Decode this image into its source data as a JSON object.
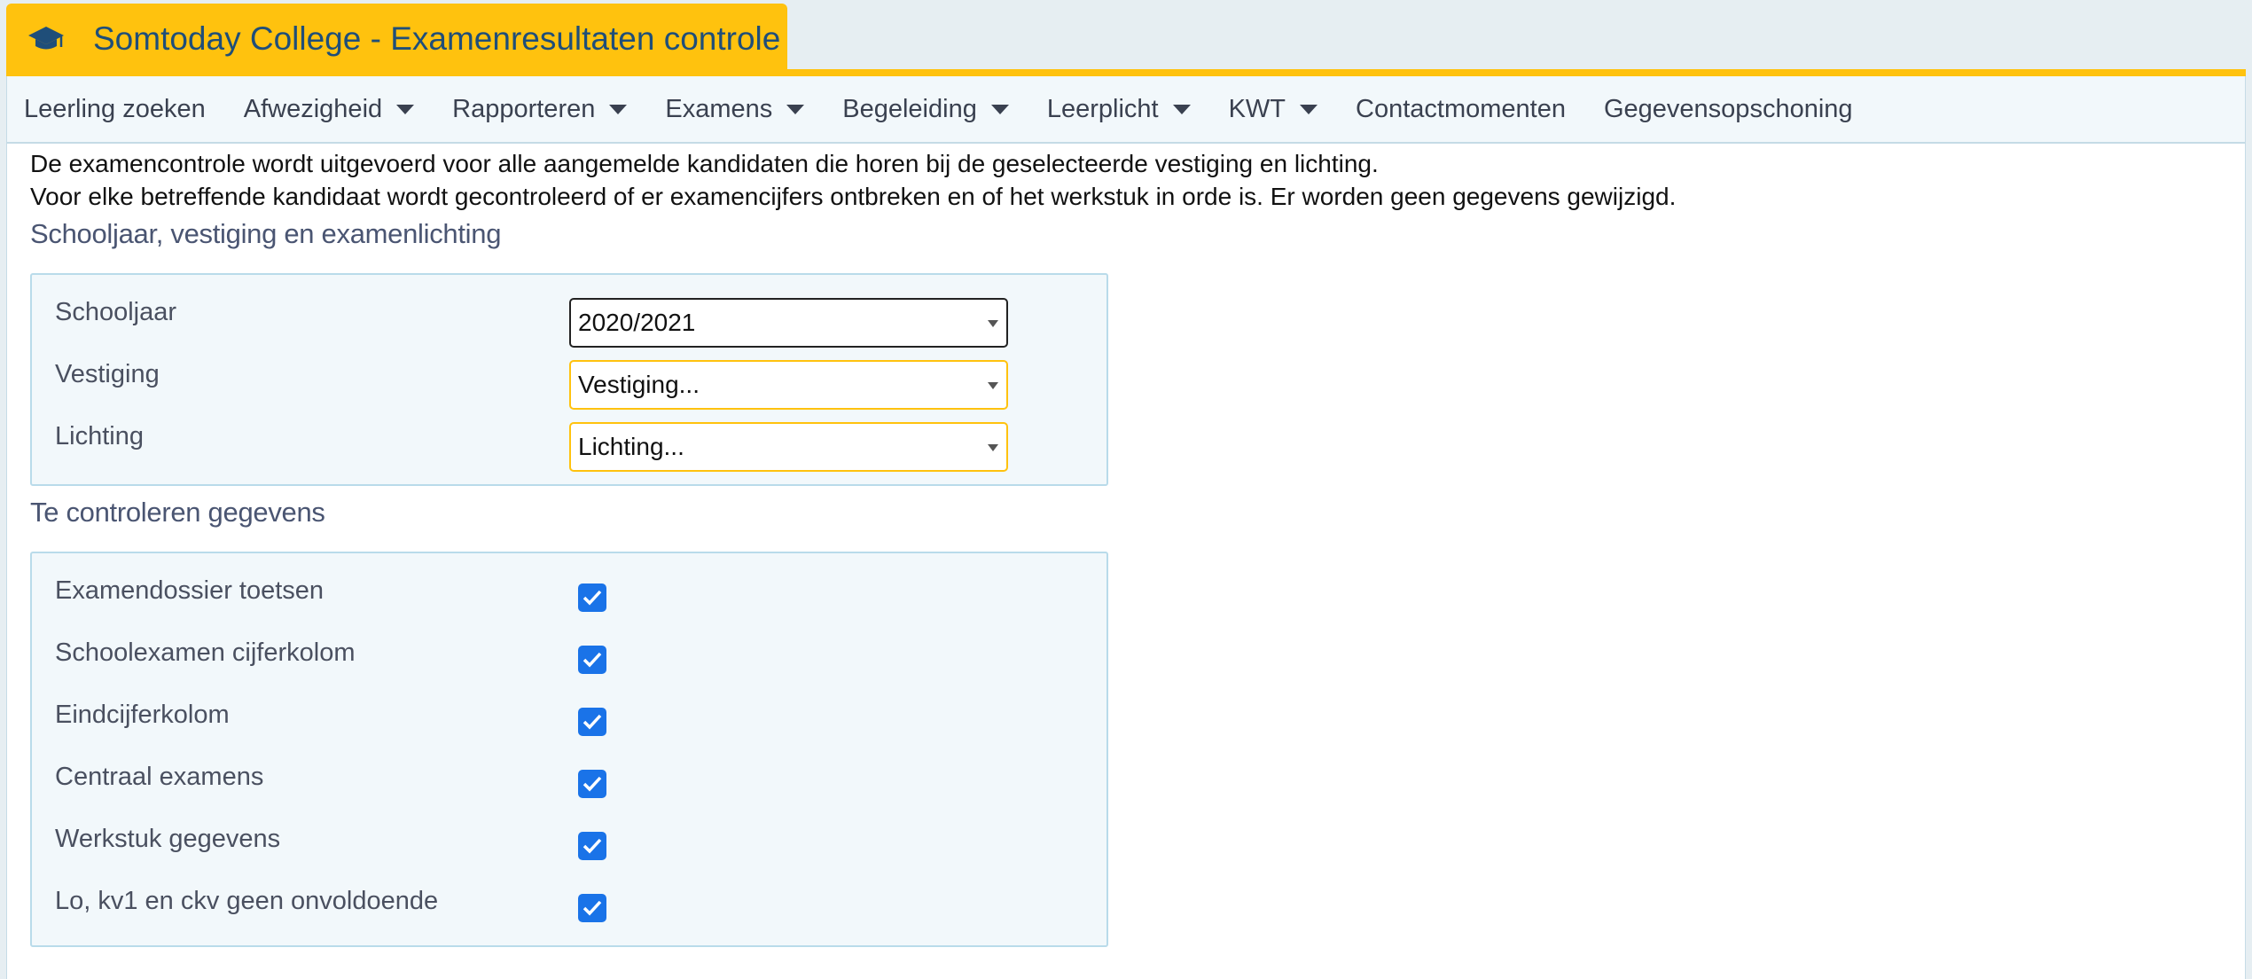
{
  "header": {
    "title": "Somtoday College - Examenresultaten controle",
    "icon": "graduation-cap-icon",
    "accent_color": "#ffc20e",
    "title_color": "#1f4e79"
  },
  "menu": {
    "items": [
      {
        "label": "Leerling zoeken",
        "dropdown": false
      },
      {
        "label": "Afwezigheid",
        "dropdown": true
      },
      {
        "label": "Rapporteren",
        "dropdown": true
      },
      {
        "label": "Examens",
        "dropdown": true
      },
      {
        "label": "Begeleiding",
        "dropdown": true
      },
      {
        "label": "Leerplicht",
        "dropdown": true
      },
      {
        "label": "KWT",
        "dropdown": true
      },
      {
        "label": "Contactmomenten",
        "dropdown": false
      },
      {
        "label": "Gegevensopschoning",
        "dropdown": false
      }
    ]
  },
  "intro": {
    "line1": "De examencontrole wordt uitgevoerd voor alle aangemelde kandidaten die horen bij de geselecteerde vestiging en lichting.",
    "line2": "Voor elke betreffende kandidaat wordt gecontroleerd of er examencijfers ontbreken en of het werkstuk in orde is. Er worden geen gegevens gewijzigd."
  },
  "selection": {
    "title": "Schooljaar, vestiging en examenlichting",
    "fields": [
      {
        "label": "Schooljaar",
        "value": "2020/2021"
      },
      {
        "label": "Vestiging",
        "value": "Vestiging..."
      },
      {
        "label": "Lichting",
        "value": "Lichting..."
      }
    ]
  },
  "checks": {
    "title": "Te controleren gegevens",
    "items": [
      {
        "label": "Examendossier toetsen",
        "checked": true
      },
      {
        "label": "Schoolexamen cijferkolom",
        "checked": true
      },
      {
        "label": "Eindcijferkolom",
        "checked": true
      },
      {
        "label": "Centraal examens",
        "checked": true
      },
      {
        "label": "Werkstuk gegevens",
        "checked": true
      },
      {
        "label": "Lo, kv1 en ckv geen onvoldoende",
        "checked": true
      }
    ],
    "checkbox_color": "#1a73e8"
  }
}
